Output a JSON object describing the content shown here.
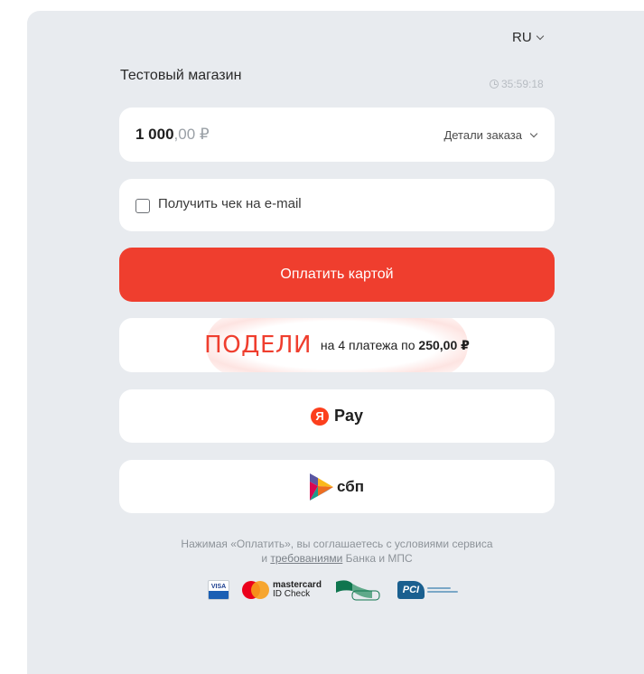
{
  "header": {
    "language": "RU",
    "shop_name": "Тестовый магазин",
    "timer": "35:59:18"
  },
  "order": {
    "amount_int": "1 000",
    "amount_dec": ",00 ₽",
    "details_label": "Детали заказа"
  },
  "receipt": {
    "checkbox_label": "Получить чек на e-mail",
    "checked": false
  },
  "actions": {
    "pay_card_label": "Оплатить картой",
    "podeli_logo": "ПОДЕЛИ",
    "podeli_text_prefix": "на 4 платежа по",
    "podeli_amount": "250,00 ₽",
    "yandex_badge": "Я",
    "yandex_pay_label": "Pay",
    "sbp_label": "сбп"
  },
  "footer": {
    "terms_line1": "Нажимая «Оплатить», вы соглашаетесь с условиями сервиса",
    "terms_line2_pre": "и ",
    "terms_link": "требованиями",
    "terms_line2_post": " Банка и МПС",
    "visa_text": "VISA",
    "mastercard_line1": "mastercard",
    "mastercard_line2": "ID Check",
    "pci_text": "PCI"
  },
  "colors": {
    "accent": "#ef3e2e",
    "panel_bg": "#e8ebef",
    "yandex_red": "#fc3f1d"
  }
}
